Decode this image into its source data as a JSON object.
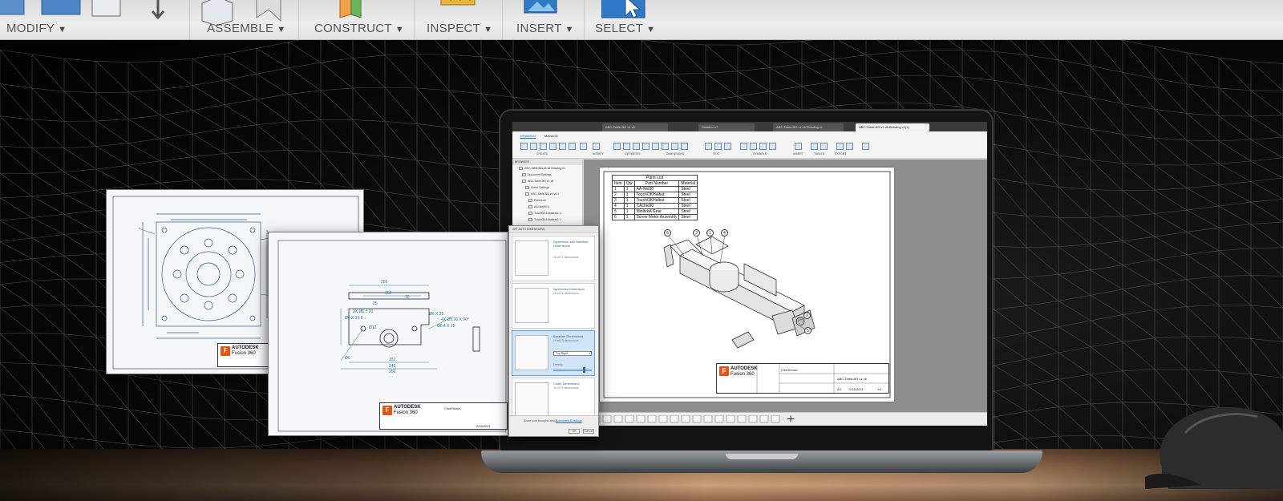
{
  "ribbon": {
    "groups": [
      {
        "label": "MODIFY"
      },
      {
        "label": "ASSEMBLE"
      },
      {
        "label": "CONSTRUCT"
      },
      {
        "label": "INSPECT"
      },
      {
        "label": "INSERT"
      },
      {
        "label": "SELECT"
      }
    ]
  },
  "laptop": {
    "tabs": [
      "ABC-Table-BG v1 v5",
      "Rotation v7",
      "ABC-Table-BG v1 v6 Drawing v1",
      "ABC-Table-BG v1 v6 Drawing v1(1)"
    ],
    "subtabs": [
      "DRAWING",
      "MANAGE"
    ],
    "tool_groups": [
      "CREATE",
      "MODIFY",
      "GEOMETRY",
      "DIMENSIONS",
      "TEXT",
      "SYMBOLS",
      "INSERT",
      "TABLES",
      "EXPORT"
    ],
    "browser": {
      "header": "BROWSER",
      "items": [
        "ABC-Table-BG v1 v6 Drawing v1",
        "Document Settings",
        "ABC-Table-BG v1 v6",
        "Sheet Settings",
        "ABC-Table-BG v1 v6:1",
        "Parts List",
        "AAI-Net90:1",
        "TouchOKJ-illustrat1:1",
        "TouchOKJ-illustrat1:1"
      ]
    },
    "parts_list": {
      "title": "Parts List",
      "headers": [
        "Item",
        "Qty",
        "Part Number",
        "Material"
      ],
      "rows": [
        [
          "1",
          "1",
          "AA-Net90",
          "Steel"
        ],
        [
          "2",
          "1",
          "TouchOKHalbut",
          "Steel"
        ],
        [
          "3",
          "1",
          "TouchOKHalbut",
          "Steel"
        ],
        [
          "4",
          "1",
          "CAchie90",
          "Steel"
        ],
        [
          "5",
          "1",
          "MinitekA Gear",
          "Steel"
        ],
        [
          "6",
          "1",
          "Screw Motor Assembly",
          "Steel"
        ]
      ]
    },
    "balloons": [
      "6",
      "3",
      "1",
      "4",
      "2",
      "5"
    ],
    "title_block": {
      "brand": "AUTODESK",
      "product": "Fusion 360",
      "drawn_by": "Clint Brown",
      "title": "ABC-Table-BG v1 v6",
      "size": "A3",
      "date": "2/16/2021",
      "sheet": "1/1"
    }
  },
  "drawing1": {
    "brand": "AUTODESK",
    "product": "Fusion 360"
  },
  "drawing2": {
    "brand": "AUTODESK",
    "product": "Fusion 360",
    "author": "Clint Brown",
    "date": "2/16/2021",
    "dims": [
      "256",
      "152",
      "70",
      "25",
      "2X Ø6 ± 20",
      "Ø6 X 15.6 ↓",
      "Ø6 X 25",
      "4X Ø5.26 X 90°",
      "Ø6.4 X 25",
      "152",
      "246",
      "Ø12",
      "256",
      "Ø6"
    ]
  },
  "auto_dim_panel": {
    "title": "SET AUTO DIMENSIONS",
    "options": [
      {
        "label": "Symmetric with Baseline Dimensions",
        "sub": "15 of 17 dimensions"
      },
      {
        "label": "Symmetric Dimension",
        "sub": "16 of 16 dimensions"
      },
      {
        "label": "Baseline Dimensions",
        "sub": "19 of 19 dimensions",
        "placement": "Top Right",
        "density_label": "Density"
      },
      {
        "label": "Chain Dimensions",
        "sub": "19 of 19 dimensions"
      }
    ],
    "footer_text": "Share your thoughts about",
    "footer_link": "Automated Drawings",
    "ok": "OK",
    "cancel": "Cancel"
  },
  "colors": {
    "accent_orange": "#e8520f",
    "accent_blue": "#1a6fc4",
    "panel_selected": "#cfe4f7"
  }
}
